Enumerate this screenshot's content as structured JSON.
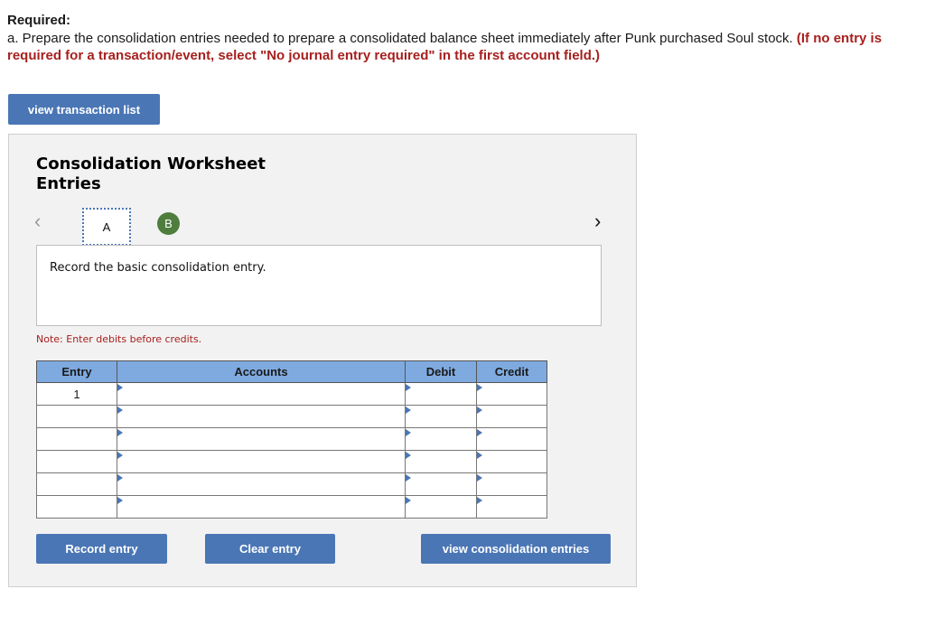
{
  "question": {
    "required_label": "Required:",
    "instruction": "a. Prepare the consolidation entries needed to prepare a consolidated balance sheet immediately after Punk purchased Soul stock.",
    "instruction_red": "(If no entry is required for a transaction/event, select \"No journal entry required\" in the first account field.)"
  },
  "toolbar": {
    "view_transaction_list": "view transaction list"
  },
  "worksheet": {
    "title_line1": "Consolidation Worksheet",
    "title_line2": "Entries",
    "nav": {
      "prev_icon": "‹",
      "next_icon": "›"
    },
    "tabs": [
      {
        "label": "A",
        "state": "active"
      },
      {
        "label": "B",
        "state": "completed",
        "color": "#4e7d3e"
      }
    ],
    "prompt": "Record the basic consolidation entry.",
    "note": "Note: Enter debits before credits.",
    "table": {
      "columns": [
        "Entry",
        "Accounts",
        "Debit",
        "Credit"
      ],
      "rows": [
        {
          "entry": "1",
          "account": "",
          "debit": "",
          "credit": ""
        },
        {
          "entry": "",
          "account": "",
          "debit": "",
          "credit": ""
        },
        {
          "entry": "",
          "account": "",
          "debit": "",
          "credit": ""
        },
        {
          "entry": "",
          "account": "",
          "debit": "",
          "credit": ""
        },
        {
          "entry": "",
          "account": "",
          "debit": "",
          "credit": ""
        },
        {
          "entry": "",
          "account": "",
          "debit": "",
          "credit": ""
        }
      ]
    },
    "buttons": {
      "record": "Record entry",
      "clear": "Clear entry",
      "view_entries": "view consolidation entries"
    }
  },
  "colors": {
    "accent": "#4a76b5",
    "header_blue": "#7faae0",
    "warning_red": "#a7201e",
    "completed_green": "#4e7d3e"
  }
}
